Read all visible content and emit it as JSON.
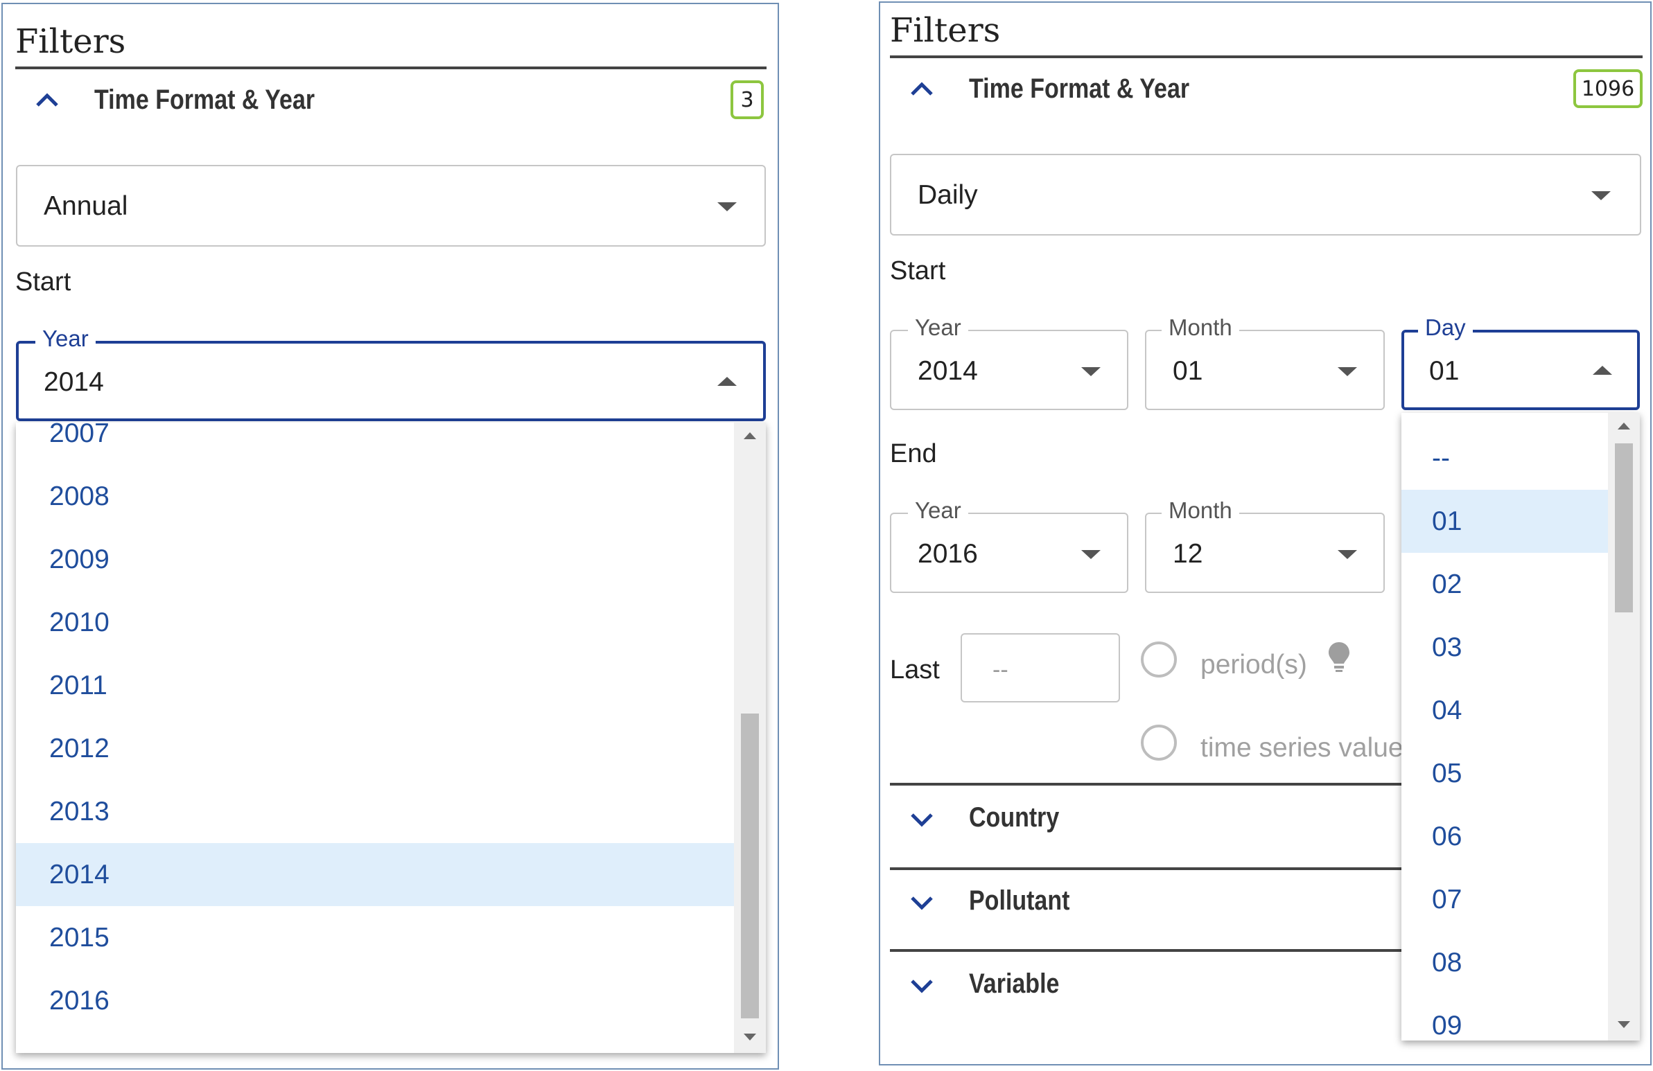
{
  "left": {
    "title": "Filters",
    "section_title": "Time Format & Year",
    "badge": "3",
    "time_format": "Annual",
    "start_label": "Start",
    "year_legend": "Year",
    "year_value": "2014",
    "year_options": [
      "2007",
      "2008",
      "2009",
      "2010",
      "2011",
      "2012",
      "2013",
      "2014",
      "2015",
      "2016"
    ],
    "selected_option": "2014"
  },
  "right": {
    "title": "Filters",
    "section_title": "Time Format & Year",
    "badge": "1096",
    "time_format": "Daily",
    "start_label": "Start",
    "start": {
      "year_legend": "Year",
      "year_value": "2014",
      "month_legend": "Month",
      "month_value": "01",
      "day_legend": "Day",
      "day_value": "01"
    },
    "end_label": "End",
    "end": {
      "year_legend": "Year",
      "year_value": "2016",
      "month_legend": "Month",
      "month_value": "12"
    },
    "last_label": "Last",
    "last_placeholder": "--",
    "radio_period": "period(s)",
    "radio_series": "time series value",
    "collapsed_sections": [
      "Country",
      "Pollutant",
      "Variable"
    ],
    "day_options": [
      "--",
      "01",
      "02",
      "03",
      "04",
      "05",
      "06",
      "07",
      "08",
      "09"
    ],
    "selected_option": "01"
  },
  "colors": {
    "accent": "#1e3f95",
    "badge_border": "#8dc63f",
    "option_text": "#1f4d9c",
    "selected_bg": "#dfeefb"
  },
  "icons": {
    "expanded": "chevron-up-icon",
    "collapsed": "chevron-down-icon",
    "hint": "lightbulb-icon",
    "dropdown": "caret-down-icon"
  }
}
